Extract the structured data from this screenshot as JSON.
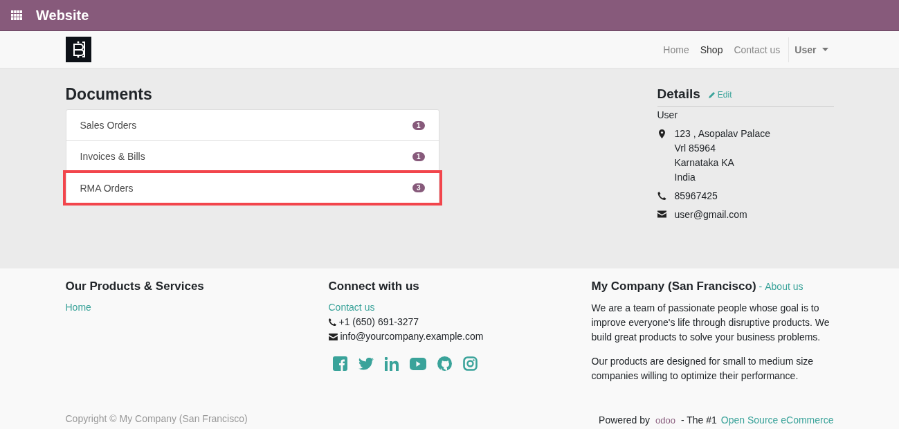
{
  "app_bar": {
    "title": "Website"
  },
  "nav": {
    "items": [
      {
        "label": "Home",
        "selected": false
      },
      {
        "label": "Shop",
        "selected": true
      },
      {
        "label": "Contact us",
        "selected": false
      }
    ],
    "user": "User"
  },
  "documents": {
    "title": "Documents",
    "items": [
      {
        "label": "Sales Orders",
        "count": "1",
        "highlighted": false
      },
      {
        "label": "Invoices & Bills",
        "count": "1",
        "highlighted": false
      },
      {
        "label": "RMA Orders",
        "count": "3",
        "highlighted": true
      }
    ]
  },
  "details": {
    "title": "Details",
    "edit": "Edit",
    "name": "User",
    "address": [
      "123 , Asopalav Palace",
      "Vrl 85964",
      "Karnataka KA",
      "India"
    ],
    "phone": "85967425",
    "email": "user@gmail.com"
  },
  "footer": {
    "products": {
      "title": "Our Products & Services",
      "links": [
        "Home"
      ]
    },
    "connect": {
      "title": "Connect with us",
      "link": "Contact us",
      "phone": "+1 (650) 691-3277",
      "email": "info@yourcompany.example.com"
    },
    "company": {
      "title": "My Company (San Francisco)",
      "separator": "-",
      "link": "About us",
      "paragraphs": [
        "We are a team of passionate people whose goal is to improve everyone's life through disruptive products. We build great products to solve your business problems.",
        "Our products are designed for small to medium size companies willing to optimize their performance."
      ]
    },
    "copyright": "Copyright © My Company (San Francisco)",
    "powered_by": "Powered by",
    "logo": "odoo",
    "tagline": "- The #1",
    "tagline_link": "Open Source eCommerce"
  }
}
